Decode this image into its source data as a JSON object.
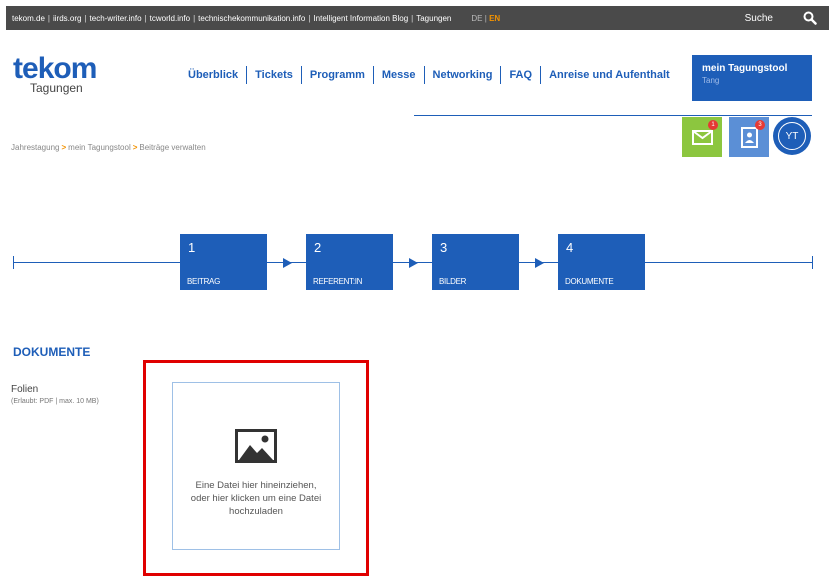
{
  "topbar": {
    "links": [
      "tekom.de",
      "iirds.org",
      "tech-writer.info",
      "tcworld.info",
      "technischekommunikation.info",
      "Intelligent Information Blog",
      "Tagungen"
    ],
    "lang_de": "DE",
    "lang_sep": "|",
    "lang_en": "EN",
    "search_label": "Suche",
    "search_icon": "search-icon"
  },
  "logo": {
    "te": "te",
    "kom": "kom",
    "sub": "Tagungen"
  },
  "nav": {
    "items": [
      "Überblick",
      "Tickets",
      "Programm",
      "Messe",
      "Networking",
      "FAQ",
      "Anreise und Aufenthalt"
    ]
  },
  "tool_button": {
    "title": "mein Tagungstool",
    "subtitle": "Tang"
  },
  "breadcrumb": {
    "item1": "Jahrestagung",
    "item2": "mein Tagungstool",
    "item3": "Beiträge verwalten",
    "sep": ">"
  },
  "user_icons": {
    "mail_badge": "1",
    "contact_badge": "3",
    "avatar_initials": "YT",
    "mail_color": "#8cc63f",
    "contact_color": "#5b8fd6"
  },
  "steps": [
    {
      "num": "1",
      "label": "BEITRAG"
    },
    {
      "num": "2",
      "label": "REFERENT:IN"
    },
    {
      "num": "3",
      "label": "BILDER"
    },
    {
      "num": "4",
      "label": "DOKUMENTE"
    }
  ],
  "section": {
    "title": "DOKUMENTE"
  },
  "field": {
    "label": "Folien",
    "hint": "(Erlaubt: PDF | max. 10 MB)"
  },
  "dropzone": {
    "icon": "image-icon",
    "line1": "Eine Datei hier hineinziehen,",
    "line2": "oder hier klicken um eine Datei",
    "line3": "hochzuladen"
  },
  "colors": {
    "brand_blue": "#1e5eb8",
    "accent_orange": "#f29200",
    "highlight_red": "#e00000"
  }
}
